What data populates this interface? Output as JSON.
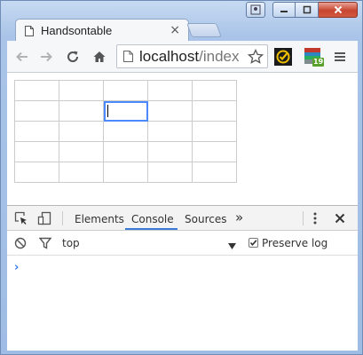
{
  "browser": {
    "tab": {
      "title": "Handsontable",
      "close_glyph": "×"
    },
    "address": {
      "host": "localhost",
      "path": "/index"
    },
    "extension_badge": "19"
  },
  "page": {
    "grid": {
      "rows": 5,
      "cols": 5,
      "selected_row": 1,
      "selected_col": 2
    }
  },
  "devtools": {
    "tabs": [
      {
        "label": "Elements"
      },
      {
        "label": "Console",
        "active": true
      },
      {
        "label": "Sources"
      }
    ],
    "more_tabs_glyph": "»",
    "context": "top",
    "preserve_log_label": "Preserve log",
    "preserve_log_checked": true,
    "prompt_glyph": "›"
  },
  "colors": {
    "accent": "#3879d9",
    "selection": "#4b89ff",
    "close": "#c7452f"
  }
}
